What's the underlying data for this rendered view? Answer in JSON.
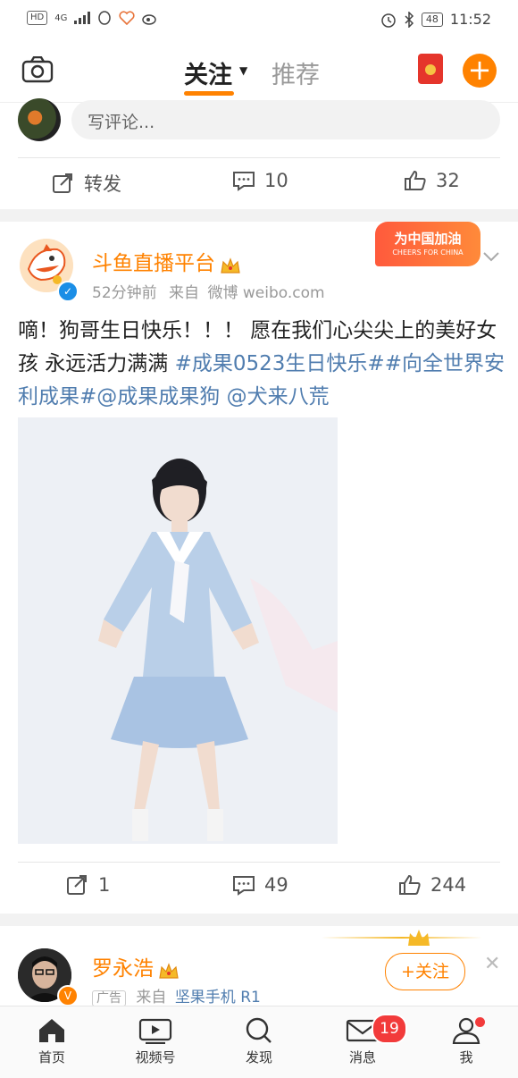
{
  "status_bar": {
    "hd": "HD",
    "network": "4G",
    "battery": "48",
    "time": "11:52"
  },
  "top_nav": {
    "follow_tab": "关注",
    "recommend_tab": "推荐"
  },
  "post1": {
    "comment_placeholder": "写评论...",
    "repost_label": "转发",
    "comment_count": "10",
    "like_count": "32"
  },
  "post2": {
    "author": "斗鱼直播平台",
    "time": "52分钟前",
    "source_prefix": "来自",
    "source": "微博 weibo.com",
    "promo_title": "为中国加油",
    "promo_sub": "CHEERS FOR CHINA",
    "text_plain": "嘀！狗哥生日快乐！！！ 愿在我们心尖尖上的美好女孩 永远活力满满 ",
    "text_tags": "#成果0523生日快乐##向全世界安利成果#@成果成果狗 @犬来八荒",
    "repost_count": "1",
    "comment_count": "49",
    "like_count": "244"
  },
  "post3": {
    "author": "罗永浩",
    "ad_tag": "广告",
    "source_prefix": "来自",
    "source": "坚果手机 R1",
    "follow_button": "+关注"
  },
  "tab_bar": {
    "home": "首页",
    "video": "视频号",
    "discover": "发现",
    "messages": "消息",
    "messages_badge": "19",
    "me": "我"
  },
  "colors": {
    "accent": "#ff8200",
    "link": "#507daf",
    "badge": "#f23b3b"
  }
}
